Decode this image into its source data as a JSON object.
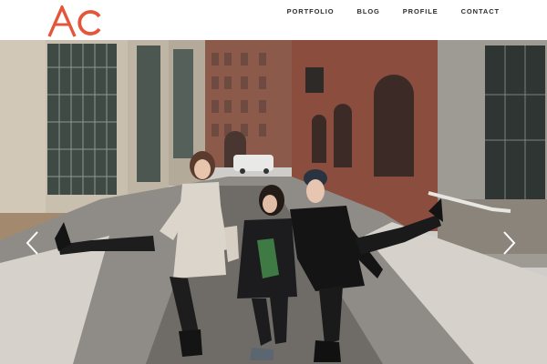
{
  "header": {
    "logo_text": "AC",
    "nav": [
      {
        "label": "PORTFOLIO"
      },
      {
        "label": "BLOG"
      },
      {
        "label": "PROFILE"
      },
      {
        "label": "CONTACT"
      }
    ]
  },
  "hero": {
    "image_subject": "street photo of three people posing",
    "prev_icon": "chevron-left-icon",
    "next_icon": "chevron-right-icon"
  },
  "colors": {
    "brand": "#e4553a",
    "nav_text": "#2d2d2d",
    "background": "#ffffff"
  }
}
